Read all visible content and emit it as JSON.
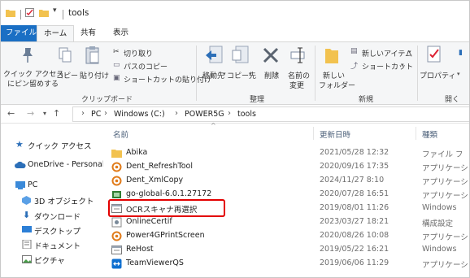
{
  "window": {
    "title": "tools"
  },
  "tabs": {
    "file": "ファイル",
    "home": "ホーム",
    "share": "共有",
    "view": "表示"
  },
  "ribbon": {
    "pin_line1": "クイック アクセス",
    "pin_line2": "にピン留めする",
    "copy": "コピー",
    "paste": "貼り付け",
    "cut": "切り取り",
    "copy_path": "パスのコピー",
    "paste_shortcut": "ショートカットの貼り付け",
    "clipboard_group": "クリップボード",
    "move_to": "移動先",
    "copy_to": "コピー先",
    "delete": "削除",
    "rename_line1": "名前の",
    "rename_line2": "変更",
    "organize_group": "整理",
    "new_folder_line1": "新しい",
    "new_folder_line2": "フォルダー",
    "new_item": "新しいアイテム",
    "shortcut": "ショートカット",
    "new_group": "新規",
    "properties": "プロパティ",
    "open_group": "開く"
  },
  "address": {
    "crumbs": [
      "PC",
      "Windows (C:)",
      "POWER5G",
      "tools"
    ]
  },
  "nav": {
    "quick_access": "クイック アクセス",
    "onedrive": "OneDrive - Personal",
    "pc": "PC",
    "objects3d": "3D オブジェクト",
    "downloads": "ダウンロード",
    "desktop": "デスクトップ",
    "documents": "ドキュメント",
    "pictures": "ピクチャ"
  },
  "columns": {
    "name": "名前",
    "date": "更新日時",
    "type": "種類"
  },
  "files": [
    {
      "name": "Abika",
      "date": "2021/05/28 12:32",
      "type": "ファイル フ",
      "icon": "folder-icon"
    },
    {
      "name": "Dent_RefreshTool",
      "date": "2020/09/16 17:35",
      "type": "アプリケーシ",
      "icon": "app-icon"
    },
    {
      "name": "Dent_XmlCopy",
      "date": "2024/11/27 8:10",
      "type": "アプリケーシ",
      "icon": "app-icon"
    },
    {
      "name": "go-global-6.0.1.27172",
      "date": "2020/07/28 16:51",
      "type": "アプリケーシ",
      "icon": "installer-icon"
    },
    {
      "name": "OCRスキャナ再選択",
      "date": "2019/08/01 11:26",
      "type": "Windows",
      "icon": "batch-icon"
    },
    {
      "name": "OnlineCertif",
      "date": "2023/03/27 18:21",
      "type": "構成設定",
      "icon": "config-icon"
    },
    {
      "name": "Power4GPrintScreen",
      "date": "2020/08/26 10:08",
      "type": "アプリケーシ",
      "icon": "app-icon"
    },
    {
      "name": "ReHost",
      "date": "2019/05/22 16:21",
      "type": "Windows",
      "icon": "batch-icon"
    },
    {
      "name": "TeamViewerQS",
      "date": "2019/06/06 11:29",
      "type": "アプリケーシ",
      "icon": "teamviewer-icon"
    }
  ],
  "colors": {
    "file_tab": "#1a6fc4",
    "highlight": "#e30000",
    "folder": "#f2c24f"
  }
}
